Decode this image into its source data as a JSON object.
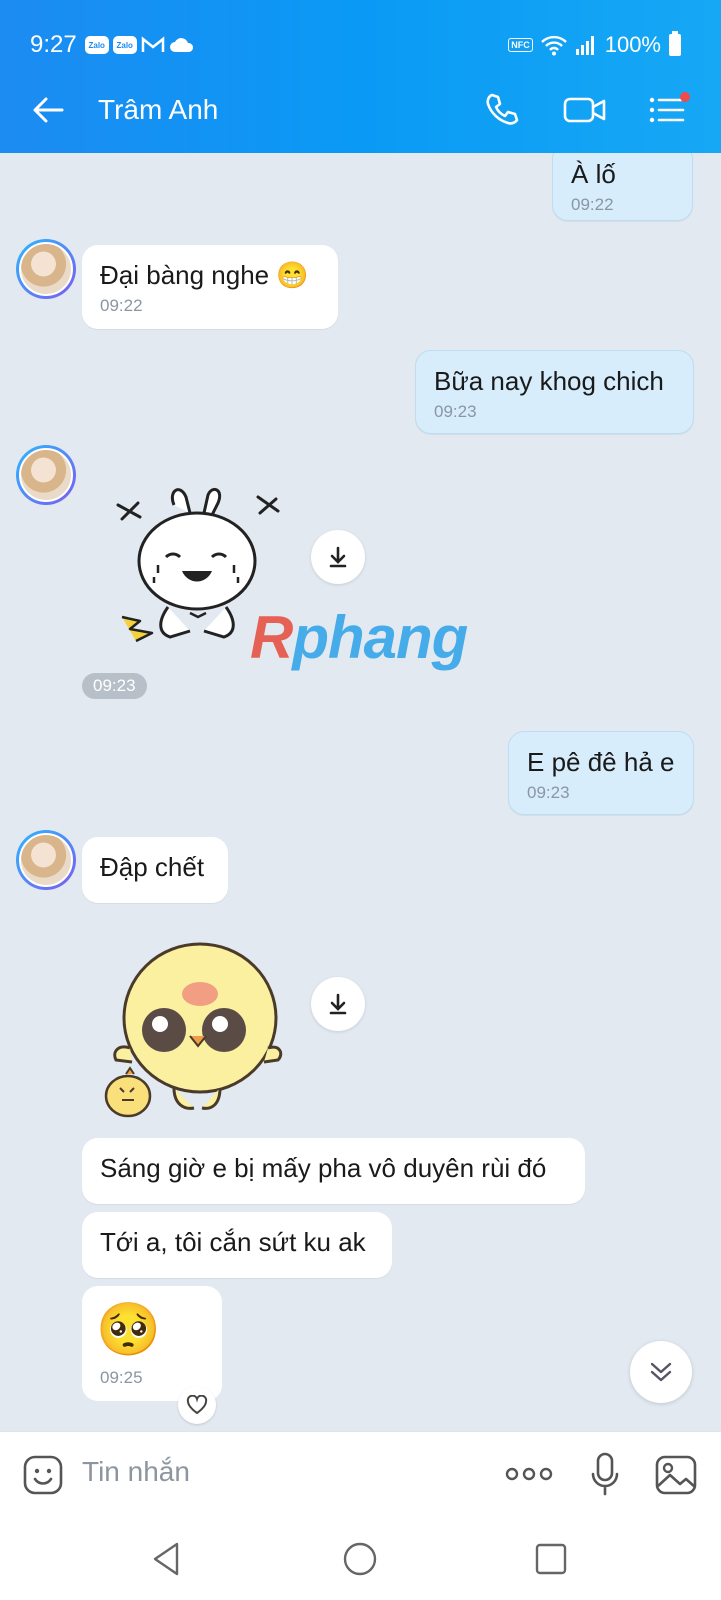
{
  "status_bar": {
    "time": "9:27",
    "app_badges": [
      "Zalo",
      "Zalo"
    ],
    "battery": "100%",
    "nfc": "NFC"
  },
  "header": {
    "title": "Trâm Anh"
  },
  "messages": [
    {
      "dir": "out",
      "text": "À lố",
      "time": "09:22"
    },
    {
      "dir": "in",
      "text": "Đại bàng nghe 😁",
      "time": "09:22"
    },
    {
      "dir": "out",
      "text": "Bữa nay khog chich",
      "time": "09:23"
    },
    {
      "dir": "in",
      "sticker": "crying-bunny-sticker",
      "time": "09:23"
    },
    {
      "dir": "out",
      "text": "E pê đê hả e",
      "time": "09:23"
    },
    {
      "dir": "in",
      "text": "Đập chết"
    },
    {
      "dir": "in",
      "sticker": "crying-chick-sticker"
    },
    {
      "dir": "in",
      "text": "Sáng giờ e bị mấy pha vô duyên rùi đó"
    },
    {
      "dir": "in",
      "text": "Tới a, tôi cắn sứt ku ak"
    },
    {
      "dir": "in",
      "emoji": "🥺",
      "time": "09:25"
    }
  ],
  "watermark": {
    "first": "R",
    "rest": "phang"
  },
  "composer": {
    "placeholder": "Tin nhắn"
  }
}
